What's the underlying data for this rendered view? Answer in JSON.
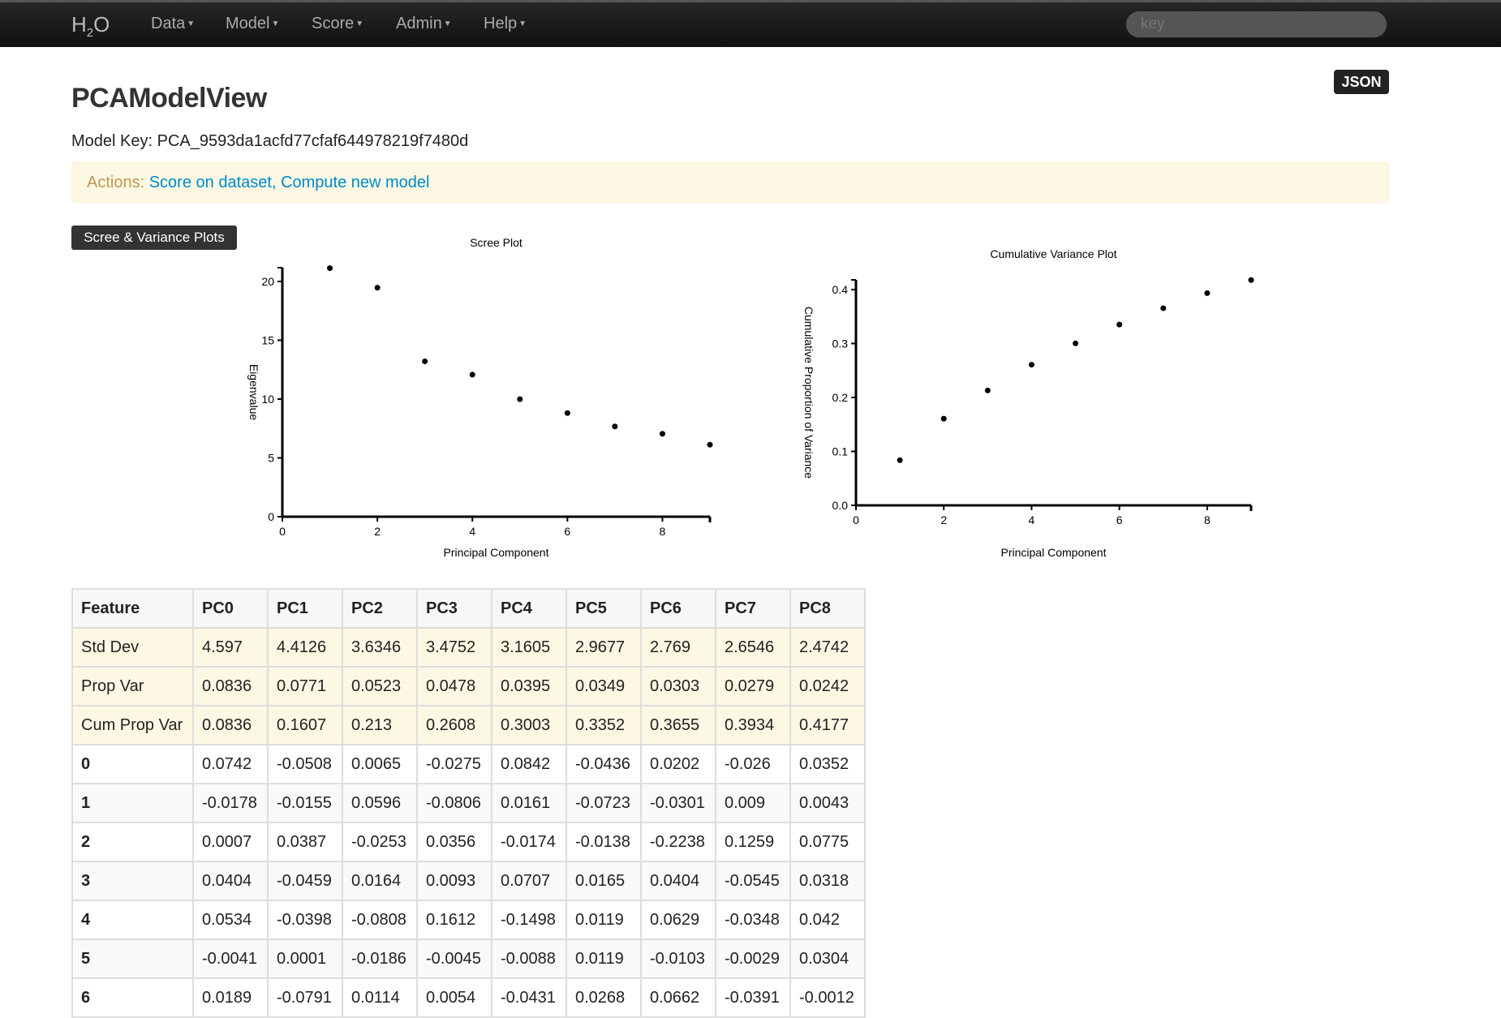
{
  "nav": {
    "logo": "H2O",
    "menus": [
      "Data",
      "Model",
      "Score",
      "Admin",
      "Help"
    ],
    "search_placeholder": "key"
  },
  "json_label": "JSON",
  "title": "PCAModelView",
  "model_key": "Model Key: PCA_9593da1acfd77cfaf644978219f7480d",
  "actions": {
    "label": "Actions:",
    "links": [
      "Score on dataset",
      "Compute new model"
    ],
    "sep": ", "
  },
  "plots_button": "Scree & Variance Plots",
  "chart_data": [
    {
      "type": "scatter",
      "title": "Scree Plot",
      "xlabel": "Principal Component",
      "ylabel": "Eigenvalue",
      "xlim": [
        0,
        9
      ],
      "ylim": [
        0,
        21
      ],
      "xticks": [
        0,
        2,
        4,
        6,
        8
      ],
      "yticks": [
        0,
        5,
        10,
        15,
        20
      ],
      "x": [
        1,
        2,
        3,
        4,
        5,
        6,
        7,
        8,
        9
      ],
      "y": [
        21.13,
        19.47,
        13.21,
        12.08,
        9.99,
        8.81,
        7.67,
        7.05,
        6.12
      ]
    },
    {
      "type": "scatter",
      "title": "Cumulative Variance Plot",
      "xlabel": "Principal Component",
      "ylabel": "Cumulative Proportion of Variance",
      "xlim": [
        0,
        9
      ],
      "ylim": [
        0,
        0.42
      ],
      "xticks": [
        0,
        2,
        4,
        6,
        8
      ],
      "yticks": [
        "0.0",
        "0.1",
        "0.2",
        "0.3",
        "0.4"
      ],
      "x": [
        1,
        2,
        3,
        4,
        5,
        6,
        7,
        8,
        9
      ],
      "y": [
        0.0836,
        0.1607,
        0.213,
        0.2608,
        0.3003,
        0.3352,
        0.3655,
        0.3934,
        0.4177
      ]
    }
  ],
  "table": {
    "headers": [
      "Feature",
      "PC0",
      "PC1",
      "PC2",
      "PC3",
      "PC4",
      "PC5",
      "PC6",
      "PC7",
      "PC8"
    ],
    "summary": [
      [
        "Std Dev",
        "4.597",
        "4.4126",
        "3.6346",
        "3.4752",
        "3.1605",
        "2.9677",
        "2.769",
        "2.6546",
        "2.4742"
      ],
      [
        "Prop Var",
        "0.0836",
        "0.0771",
        "0.0523",
        "0.0478",
        "0.0395",
        "0.0349",
        "0.0303",
        "0.0279",
        "0.0242"
      ],
      [
        "Cum Prop Var",
        "0.0836",
        "0.1607",
        "0.213",
        "0.2608",
        "0.3003",
        "0.3352",
        "0.3655",
        "0.3934",
        "0.4177"
      ]
    ],
    "rows": [
      [
        "0",
        "0.0742",
        "-0.0508",
        "0.0065",
        "-0.0275",
        "0.0842",
        "-0.0436",
        "0.0202",
        "-0.026",
        "0.0352"
      ],
      [
        "1",
        "-0.0178",
        "-0.0155",
        "0.0596",
        "-0.0806",
        "0.0161",
        "-0.0723",
        "-0.0301",
        "0.009",
        "0.0043"
      ],
      [
        "2",
        "0.0007",
        "0.0387",
        "-0.0253",
        "0.0356",
        "-0.0174",
        "-0.0138",
        "-0.2238",
        "0.1259",
        "0.0775"
      ],
      [
        "3",
        "0.0404",
        "-0.0459",
        "0.0164",
        "0.0093",
        "0.0707",
        "0.0165",
        "0.0404",
        "-0.0545",
        "0.0318"
      ],
      [
        "4",
        "0.0534",
        "-0.0398",
        "-0.0808",
        "0.1612",
        "-0.1498",
        "0.0119",
        "0.0629",
        "-0.0348",
        "0.042"
      ],
      [
        "5",
        "-0.0041",
        "0.0001",
        "-0.0186",
        "-0.0045",
        "-0.0088",
        "0.0119",
        "-0.0103",
        "-0.0029",
        "0.0304"
      ],
      [
        "6",
        "0.0189",
        "-0.0791",
        "0.0114",
        "0.0054",
        "-0.0431",
        "0.0268",
        "0.0662",
        "-0.0391",
        "-0.0012"
      ]
    ]
  }
}
